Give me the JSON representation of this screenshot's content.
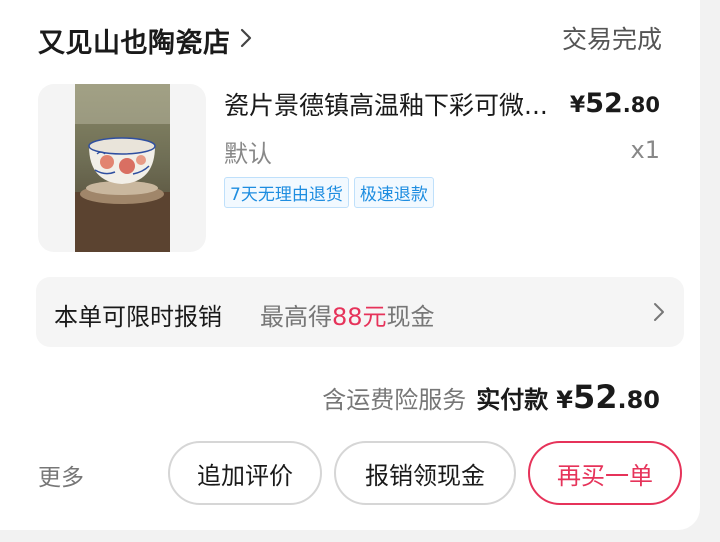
{
  "header": {
    "shop_name": "又见山也陶瓷店",
    "chevron_icon": "chevron-right-icon",
    "status": "交易完成"
  },
  "product": {
    "title": "瓷片景德镇高温釉下彩可微...",
    "price": {
      "symbol": "¥",
      "integer": "52",
      "decimal": ".80"
    },
    "variant": "默认",
    "quantity": "x1",
    "tags": [
      "7天无理由退货",
      "极速退款"
    ],
    "tag_color": "#1e8de0"
  },
  "reimburse": {
    "title": "本单可限时报销",
    "desc_prefix": "最高得",
    "desc_highlight": "88元",
    "desc_suffix": "现金",
    "highlight_color": "#e6335a"
  },
  "total": {
    "service": "含运费险服务",
    "pay_label": "实付款",
    "symbol": "¥",
    "integer": "52",
    "decimal": ".80"
  },
  "actions": {
    "more": "更多",
    "review": "追加评价",
    "cash": "报销领现金",
    "rebuy": "再买一单",
    "accent": "#e6335a"
  }
}
